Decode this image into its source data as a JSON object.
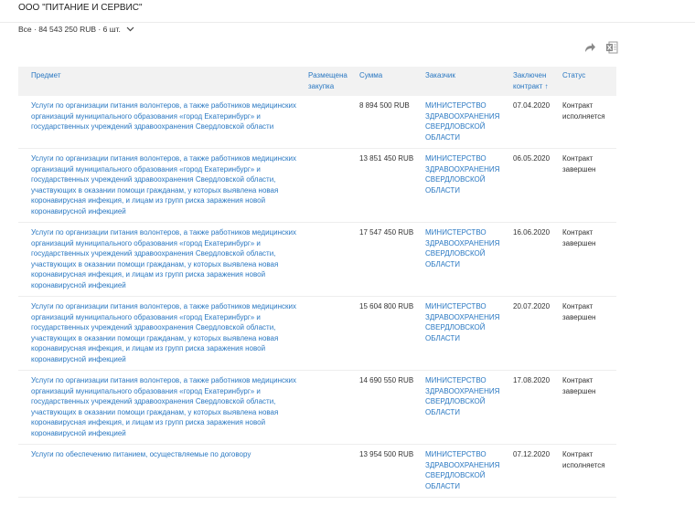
{
  "header": {
    "company": "ООО \"ПИТАНИЕ И СЕРВИС\""
  },
  "filter": {
    "label": "Все · 84 543 250 RUB · 6 шт."
  },
  "table": {
    "columns": {
      "subject": "Предмет",
      "placed": "Размещена закупка",
      "sum": "Сумма",
      "customer": "Заказчик",
      "date": "Заключен контракт ↑",
      "status": "Статус"
    },
    "rows": [
      {
        "subject": "Услуги по организации питания волонтеров, а также работников медицинских организаций муниципального образования «город Екатеринбург» и государственных учреждений здравоохранения Свердловской области",
        "sum": "8 894 500 RUB",
        "customer": "МИНИСТЕРСТВО ЗДРАВООХРАНЕНИЯ СВЕРДЛОВСКОЙ ОБЛАСТИ",
        "date": "07.04.2020",
        "status": "Контракт исполняется"
      },
      {
        "subject": "Услуги по организации питания волонтеров, а также работников медицинских организаций муниципального образования «город Екатеринбург» и государственных учреждений здравоохранения Свердловской области, участвующих в оказании помощи гражданам, у которых выявлена новая коронавирусная инфекция, и лицам из групп риска заражения новой коронавирусной инфекцией",
        "sum": "13 851 450 RUB",
        "customer": "МИНИСТЕРСТВО ЗДРАВООХРАНЕНИЯ СВЕРДЛОВСКОЙ ОБЛАСТИ",
        "date": "06.05.2020",
        "status": "Контракт завершен"
      },
      {
        "subject": "Услуги по организации питания волонтеров, а также работников медицинских организаций муниципального образования «город Екатеринбург» и государственных учреждений здравоохранения Свердловской области, участвующих в оказании помощи гражданам, у которых выявлена новая коронавирусная инфекция, и лицам из групп риска заражения новой коронавирусной инфекцией",
        "sum": "17 547 450 RUB",
        "customer": "МИНИСТЕРСТВО ЗДРАВООХРАНЕНИЯ СВЕРДЛОВСКОЙ ОБЛАСТИ",
        "date": "16.06.2020",
        "status": "Контракт завершен"
      },
      {
        "subject": "Услуги по организации питания волонтеров, а также работников медицинских организаций муниципального образования «город Екатеринбург» и государственных учреждений здравоохранения Свердловской области, участвующих в оказании помощи гражданам, у которых выявлена новая коронавирусная инфекция, и лицам из групп риска заражения новой коронавирусной инфекцией",
        "sum": "15 604 800 RUB",
        "customer": "МИНИСТЕРСТВО ЗДРАВООХРАНЕНИЯ СВЕРДЛОВСКОЙ ОБЛАСТИ",
        "date": "20.07.2020",
        "status": "Контракт завершен"
      },
      {
        "subject": "Услуги по организации питания волонтеров, а также работников медицинских организаций муниципального образования «город Екатеринбург» и государственных учреждений здравоохранения Свердловской области, участвующих в оказании помощи гражданам, у которых выявлена новая коронавирусная инфекция, и лицам из групп риска заражения новой коронавирусной инфекцией",
        "sum": "14 690 550 RUB",
        "customer": "МИНИСТЕРСТВО ЗДРАВООХРАНЕНИЯ СВЕРДЛОВСКОЙ ОБЛАСТИ",
        "date": "17.08.2020",
        "status": "Контракт завершен"
      },
      {
        "subject": "Услуги по обеспечению питанием, осуществляемые по договору",
        "sum": "13 954 500 RUB",
        "customer": "МИНИСТЕРСТВО ЗДРАВООХРАНЕНИЯ СВЕРДЛОВСКОЙ ОБЛАСТИ",
        "date": "07.12.2020",
        "status": "Контракт исполняется"
      }
    ]
  },
  "icons": {
    "share": "share-arrow-icon",
    "export": "excel-export-icon"
  },
  "colors": {
    "link": "#2a78c2",
    "header_bg": "#f2f2f2",
    "text": "#333333"
  }
}
